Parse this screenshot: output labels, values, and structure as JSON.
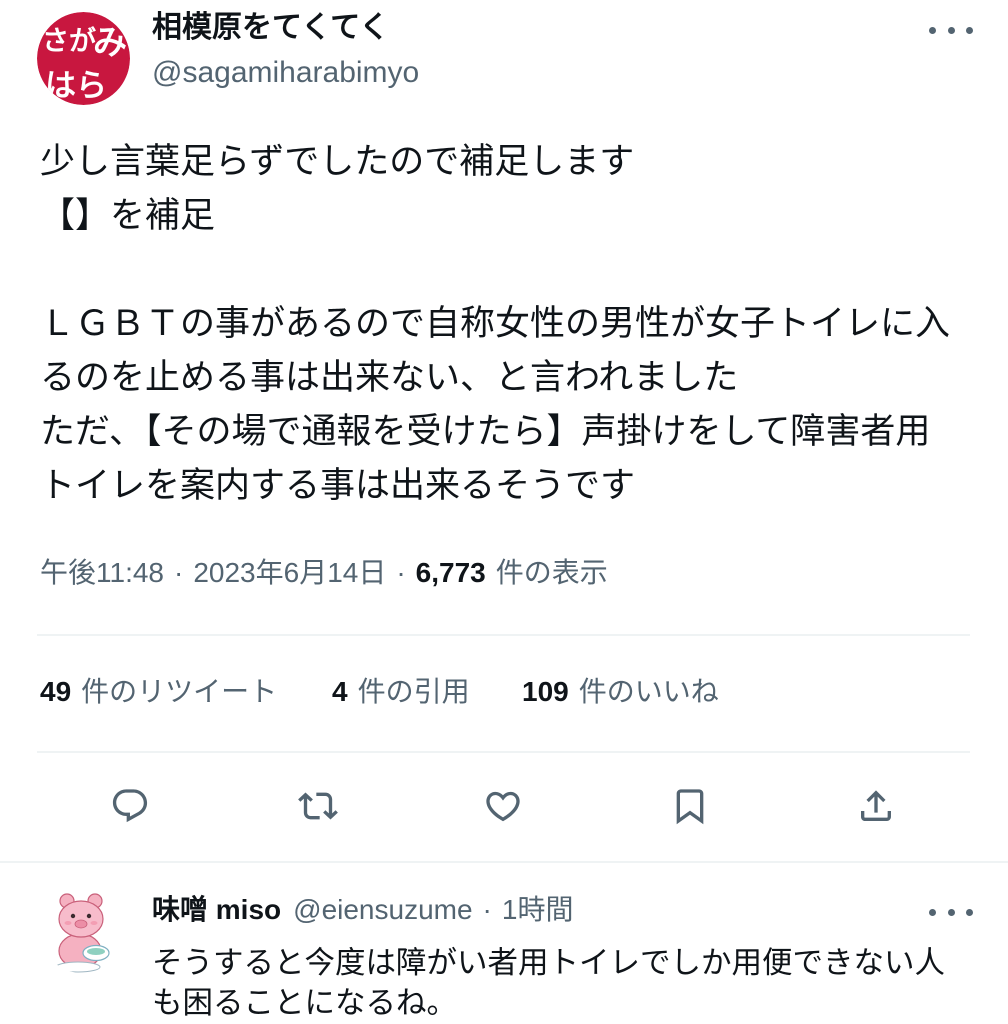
{
  "tweet": {
    "author": {
      "display_name": "相模原をてくてく",
      "handle": "@sagamiharabimyo",
      "avatar_logo_text": [
        "さが",
        "み",
        "はら"
      ]
    },
    "paragraphs": [
      [
        "少し言葉足らずでしたので補足します",
        "【】を補足"
      ],
      [
        "ＬＧＢＴの事があるので自称女性の男性が女子トイレに入",
        "るのを止める事は出来ない、と言われました",
        "ただ、【その場で通報を受けたら】声掛けをして障害者用",
        "トイレを案内する事は出来るそうです"
      ]
    ],
    "meta": {
      "time": "午後11:48",
      "separator": "·",
      "date": "2023年6月14日",
      "views_count": "6,773",
      "views_label": "件の表示"
    },
    "stats": [
      {
        "count": "49",
        "label": "件のリツイート"
      },
      {
        "count": "4",
        "label": "件の引用"
      },
      {
        "count": "109",
        "label": "件のいいね"
      }
    ],
    "icons": {
      "more": "more-horizontal-icon",
      "actions": [
        "reply-icon",
        "retweet-icon",
        "heart-icon",
        "bookmark-icon",
        "share-icon"
      ]
    }
  },
  "reply": {
    "display_name": "味噌 miso",
    "handle": "@eiensuzume",
    "separator": "·",
    "time_ago": "1時間",
    "text_lines": [
      "そうすると今度は障がい者用トイレでしか用便できない人",
      "も困ることになるね。"
    ],
    "icons": {
      "more": "more-horizontal-icon",
      "avatar": "pink-character-avatar-icon"
    }
  },
  "colors": {
    "text": "#0f1419",
    "secondary": "#536471",
    "divider": "#eff3f4",
    "avatar_red": "#c8173f",
    "reply_avatar_pink": "#f5b1c1"
  }
}
